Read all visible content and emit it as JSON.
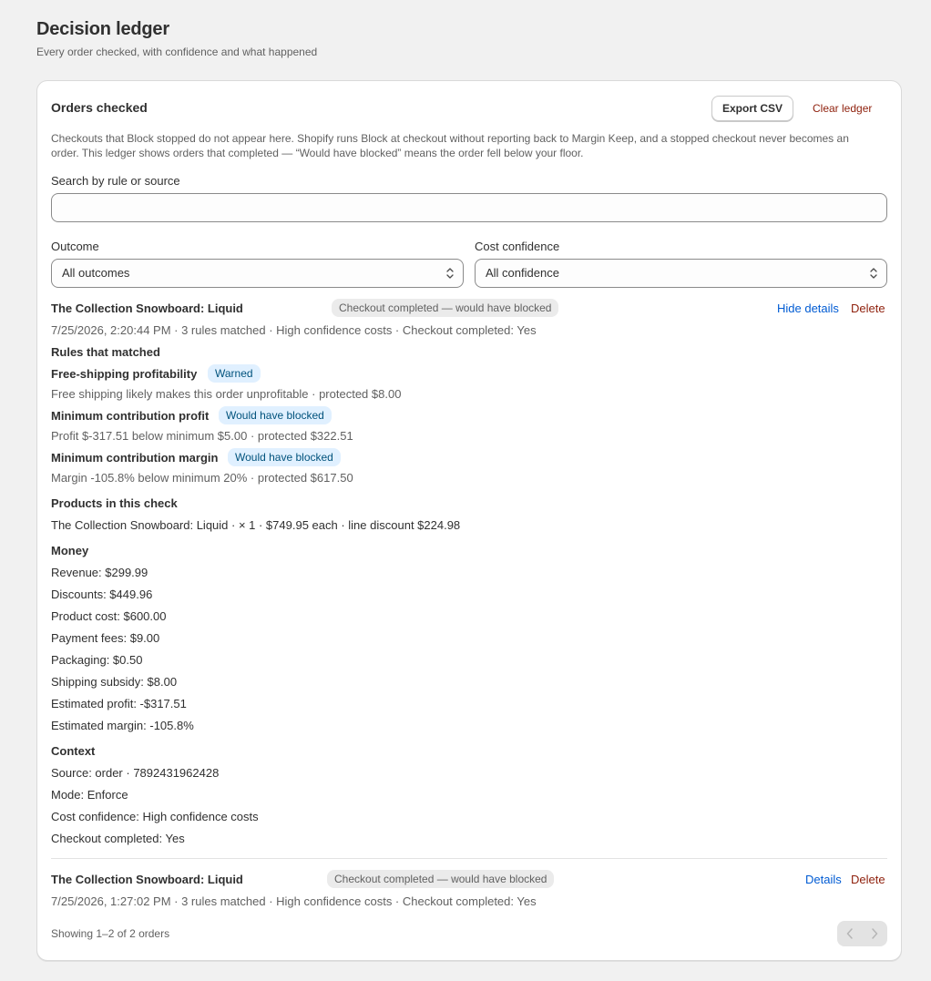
{
  "page": {
    "title": "Decision ledger",
    "subtitle": "Every order checked, with confidence and what happened"
  },
  "card": {
    "title": "Orders checked",
    "export_label": "Export CSV",
    "clear_label": "Clear ledger",
    "notice": "Checkouts that Block stopped do not appear here. Shopify runs Block at checkout without reporting back to Margin Keep, and a stopped checkout never becomes an order. This ledger shows orders that completed — “Would have blocked” means the order fell below your floor."
  },
  "search": {
    "label": "Search by rule or source",
    "value": "",
    "placeholder": ""
  },
  "filters": {
    "outcome_label": "Outcome",
    "outcome_value": "All outcomes",
    "confidence_label": "Cost confidence",
    "confidence_value": "All confidence"
  },
  "entries": [
    {
      "title": "The Collection Snowboard: Liquid",
      "status": "Checkout completed — would have blocked",
      "toggle_label": "Hide details",
      "delete_label": "Delete",
      "meta": "7/25/2026, 2:20:44 PM · 3 rules matched · High confidence costs · Checkout completed: Yes",
      "rules_heading": "Rules that matched",
      "rules": [
        {
          "name": "Free-shipping profitability",
          "badge": "Warned",
          "detail": "Free shipping likely makes this order unprofitable · protected $8.00"
        },
        {
          "name": "Minimum contribution profit",
          "badge": "Would have blocked",
          "detail": "Profit $-317.51 below minimum $5.00 · protected $322.51"
        },
        {
          "name": "Minimum contribution margin",
          "badge": "Would have blocked",
          "detail": "Margin -105.8% below minimum 20% · protected $617.50"
        }
      ],
      "products_heading": "Products in this check",
      "products": [
        "The Collection Snowboard: Liquid · × 1 · $749.95 each · line discount $224.98"
      ],
      "money_heading": "Money",
      "money": [
        "Revenue: $299.99",
        "Discounts: $449.96",
        "Product cost: $600.00",
        "Payment fees: $9.00",
        "Packaging: $0.50",
        "Shipping subsidy: $8.00",
        "Estimated profit: -$317.51",
        "Estimated margin: -105.8%"
      ],
      "context_heading": "Context",
      "context": [
        "Source: order · 7892431962428",
        "Mode: Enforce",
        "Cost confidence: High confidence costs",
        "Checkout completed: Yes"
      ]
    },
    {
      "title": "The Collection Snowboard: Liquid",
      "status": "Checkout completed — would have blocked",
      "toggle_label": "Details",
      "delete_label": "Delete",
      "meta": "7/25/2026, 1:27:02 PM · 3 rules matched · High confidence costs · Checkout completed: Yes"
    }
  ],
  "footer": {
    "showing": "Showing 1–2 of 2 orders"
  }
}
